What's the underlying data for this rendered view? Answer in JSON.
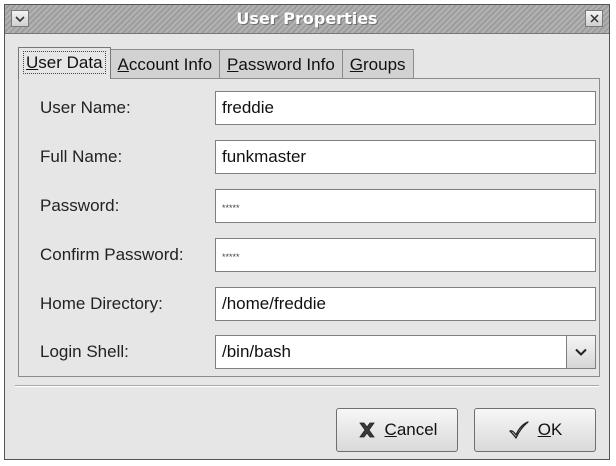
{
  "window": {
    "title": "User Properties"
  },
  "tabs": [
    {
      "label_ul": "U",
      "label_rest": "ser Data"
    },
    {
      "label_ul": "A",
      "label_rest": "ccount Info"
    },
    {
      "label_ul": "P",
      "label_rest": "assword Info"
    },
    {
      "label_ul": "G",
      "label_rest": "roups"
    }
  ],
  "form": {
    "user_name": {
      "label": "User Name:",
      "value": "freddie"
    },
    "full_name": {
      "label": "Full Name:",
      "value": "funkmaster"
    },
    "password": {
      "label": "Password:",
      "value": "*****"
    },
    "confirm_password": {
      "label": "Confirm Password:",
      "value": "*****"
    },
    "home_directory": {
      "label": "Home Directory:",
      "value": "/home/freddie"
    },
    "login_shell": {
      "label": "Login Shell:",
      "value": "/bin/bash"
    }
  },
  "buttons": {
    "cancel_ul": "C",
    "cancel_rest": "ancel",
    "ok_ul": "O",
    "ok_rest": "K"
  },
  "icons": {
    "window_menu": "chevron-down-icon",
    "window_close": "close-icon",
    "shell_dropdown": "chevron-down-icon",
    "cancel": "cancel-x-icon",
    "ok": "checkmark-icon"
  }
}
